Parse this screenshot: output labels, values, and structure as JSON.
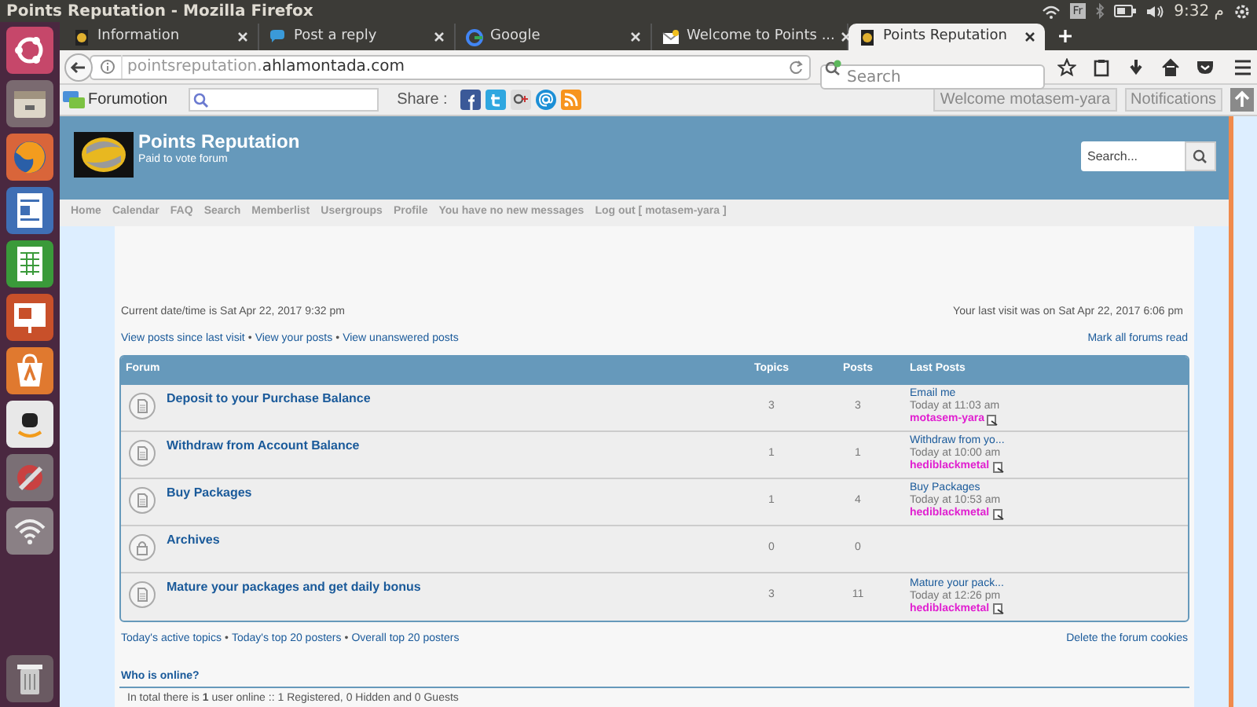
{
  "window": {
    "title": "Points Reputation - Mozilla Firefox"
  },
  "system_tray": {
    "keyboard": "Fr",
    "clock": "م 9:32"
  },
  "tabs": [
    {
      "label": "Information",
      "selected": false
    },
    {
      "label": "Post a reply",
      "selected": false
    },
    {
      "label": "Google",
      "selected": false
    },
    {
      "label": "Welcome to Points ...",
      "selected": false
    },
    {
      "label": "Points Reputation",
      "selected": true
    }
  ],
  "address_bar": {
    "url_subdomain": "pointsreputation.",
    "url_domain": "ahlamontada.com"
  },
  "browser_search": {
    "placeholder": "Search"
  },
  "forumotion_bar": {
    "brand": "Forumotion",
    "share_label": "Share :",
    "welcome": "Welcome motasem-yara",
    "notifications": "Notifications"
  },
  "forum_header": {
    "title": "Points Reputation",
    "subtitle": "Paid to vote forum",
    "search_placeholder": "Search..."
  },
  "nav_links": [
    "Home",
    "Calendar",
    "FAQ",
    "Search",
    "Memberlist",
    "Usergroups",
    "Profile",
    "You have no new messages",
    "Log out [ motasem-yara ]"
  ],
  "current_time": "Current date/time is Sat Apr 22, 2017 9:32 pm",
  "last_visit": "Your last visit was on Sat Apr 22, 2017 6:06 pm",
  "view_links": [
    {
      "kind": "link",
      "text": "View posts since last visit"
    },
    {
      "kind": "separator",
      "text": "•"
    },
    {
      "kind": "link",
      "text": "View your posts"
    },
    {
      "kind": "separator",
      "text": "•"
    },
    {
      "kind": "link",
      "text": "View unanswered posts"
    }
  ],
  "mark_read": "Mark all forums read",
  "table": {
    "columns": [
      "Forum",
      "Topics",
      "Posts",
      "Last Posts"
    ],
    "rows": [
      {
        "kind": "open",
        "title": "Deposit to your Purchase Balance",
        "topics": "3",
        "posts": "3",
        "last_post": {
          "title": "Email me",
          "time": "Today at 11:03 am",
          "author": "motasem-yara"
        }
      },
      {
        "kind": "open",
        "title": "Withdraw from Account Balance",
        "topics": "1",
        "posts": "1",
        "last_post": {
          "title": "Withdraw from yo...",
          "time": "Today at 10:00 am",
          "author": "hediblackmetal"
        }
      },
      {
        "kind": "open",
        "title": "Buy Packages",
        "topics": "1",
        "posts": "4",
        "last_post": {
          "title": "Buy Packages",
          "time": "Today at 10:53 am",
          "author": "hediblackmetal"
        }
      },
      {
        "kind": "locked",
        "title": "Archives",
        "topics": "0",
        "posts": "0"
      },
      {
        "kind": "open",
        "title": "Mature your packages and get daily bonus",
        "topics": "3",
        "posts": "11",
        "last_post": {
          "title": "Mature your pack...",
          "time": "Today at 12:26 pm",
          "author": "hediblackmetal"
        }
      }
    ]
  },
  "footer_links": [
    {
      "kind": "link",
      "text": "Today's active topics"
    },
    {
      "kind": "separator",
      "text": "•"
    },
    {
      "kind": "link",
      "text": "Today's top 20 posters"
    },
    {
      "kind": "separator",
      "text": "•"
    },
    {
      "kind": "link",
      "text": "Overall top 20 posters"
    }
  ],
  "delete_cookies": "Delete the forum cookies",
  "who_is_online": {
    "title": "Who is online?",
    "stats": "In total there is **1** user online :: 1 Registered, 0 Hidden and 0 Guests"
  }
}
